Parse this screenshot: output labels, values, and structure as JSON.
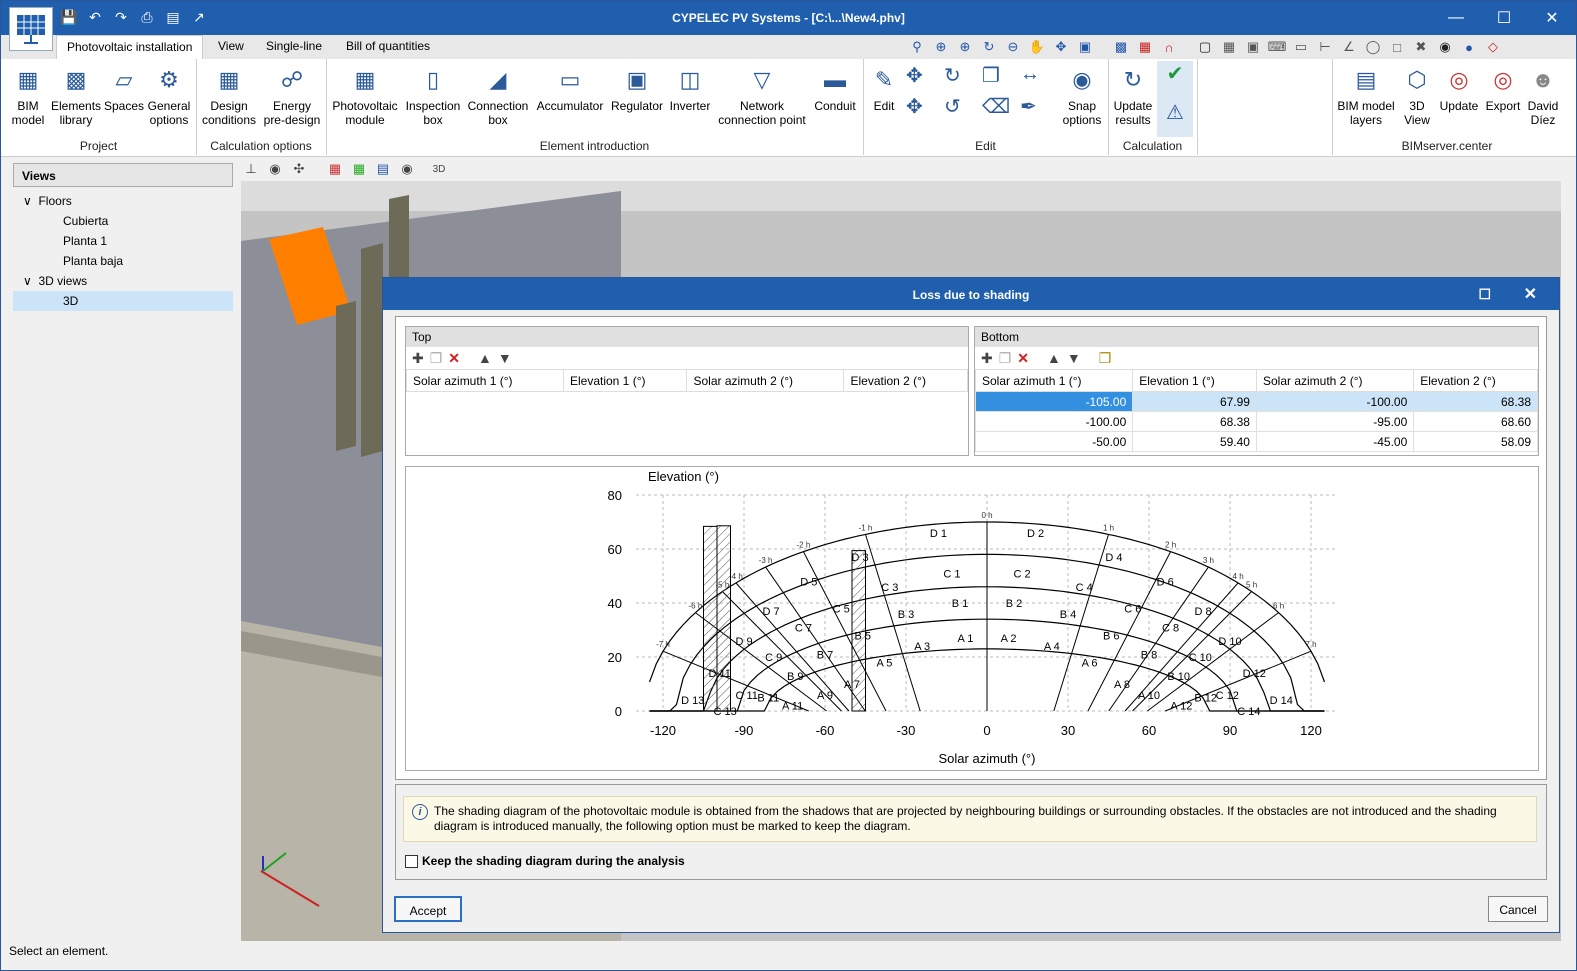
{
  "window": {
    "title": "CYPELEC PV Systems - [C:\\...\\New4.phv]"
  },
  "tabs": [
    {
      "label": "Photovoltaic installation"
    },
    {
      "label": "View"
    },
    {
      "label": "Single-line"
    },
    {
      "label": "Bill of quantities"
    }
  ],
  "ribbon": {
    "buttons": {
      "bim_model": "BIM\nmodel",
      "elements_library": "Elements\nlibrary",
      "spaces": "Spaces",
      "general_options": "General\noptions",
      "design_conditions": "Design\nconditions",
      "energy_predesign": "Energy\npre-design",
      "pv_module": "Photovoltaic\nmodule",
      "inspection_box": "Inspection\nbox",
      "connection_box": "Connection\nbox",
      "accumulator": "Accumulator",
      "regulator": "Regulator",
      "inverter": "Inverter",
      "network_point": "Network\nconnection point",
      "conduit": "Conduit",
      "edit": "Edit",
      "snap_options": "Snap\noptions",
      "update_results": "Update\nresults",
      "bim_layers": "BIM model\nlayers",
      "view3d": "3D\nView",
      "update": "Update",
      "export": "Export",
      "user": "David\nDíez"
    },
    "groups": {
      "project": "Project",
      "calc_options": "Calculation options",
      "element_intro": "Element introduction",
      "edit": "Edit",
      "calculation": "Calculation",
      "bimserver": "BIMserver.center"
    }
  },
  "sidebar": {
    "header": "Views",
    "floors_label": "Floors",
    "floors": [
      "Cubierta",
      "Planta 1",
      "Planta baja"
    ],
    "views_label": "3D views",
    "views": [
      "3D"
    ]
  },
  "status": "Select an element.",
  "dialog": {
    "title": "Loss due to shading",
    "top": {
      "label": "Top",
      "columns": [
        "Solar azimuth 1 (°)",
        "Elevation 1 (°)",
        "Solar azimuth 2 (°)",
        "Elevation 2 (°)"
      ]
    },
    "bottom": {
      "label": "Bottom",
      "columns": [
        "Solar azimuth 1 (°)",
        "Elevation 1 (°)",
        "Solar azimuth 2 (°)",
        "Elevation 2 (°)"
      ],
      "rows": [
        [
          "-105.00",
          "67.99",
          "-100.00",
          "68.38"
        ],
        [
          "-100.00",
          "68.38",
          "-95.00",
          "68.60"
        ],
        [
          "-50.00",
          "59.40",
          "-45.00",
          "58.09"
        ]
      ]
    },
    "info": "The shading diagram of the photovoltaic module is obtained from the shadows that are projected by neighbouring buildings or surrounding obstacles. If the obstacles are not introduced and the shading diagram is introduced manually, the following option must be marked to keep the diagram.",
    "checkbox_label": "Keep the shading diagram during the analysis",
    "accept": "Accept",
    "cancel": "Cancel"
  },
  "chart_data": {
    "type": "scatter",
    "xlabel": "Solar azimuth (°)",
    "ylabel": "Elevation (°)",
    "xlim": [
      -130,
      130
    ],
    "ylim": [
      0,
      80
    ],
    "xticks": [
      -120,
      -90,
      -60,
      -30,
      0,
      30,
      60,
      90,
      120
    ],
    "yticks": [
      0,
      20,
      40,
      60,
      80
    ],
    "grid": true,
    "sun_arcs_elevation_at_noon": [
      23,
      34,
      46,
      58,
      70
    ],
    "hour_labels": [
      "-7 h",
      "-6 h",
      "-5 h",
      "-4 h",
      "-3 h",
      "-2 h",
      "-1 h",
      "0 h",
      "1 h",
      "2 h",
      "3 h",
      "4 h",
      "5 h",
      "6 h",
      "7 h"
    ],
    "hour_azimuths": [
      -120,
      -108,
      -98,
      -93,
      -82,
      -68,
      -45,
      0,
      45,
      68,
      82,
      93,
      98,
      108,
      120
    ],
    "zones": [
      {
        "label": "D 1",
        "x": -18,
        "y": 66
      },
      {
        "label": "D 2",
        "x": 18,
        "y": 66
      },
      {
        "label": "D 3",
        "x": -47,
        "y": 57
      },
      {
        "label": "D 4",
        "x": 47,
        "y": 57
      },
      {
        "label": "D 5",
        "x": -66,
        "y": 48
      },
      {
        "label": "D 6",
        "x": 66,
        "y": 48
      },
      {
        "label": "D 7",
        "x": -80,
        "y": 37
      },
      {
        "label": "D 8",
        "x": 80,
        "y": 37
      },
      {
        "label": "D 9",
        "x": -90,
        "y": 26
      },
      {
        "label": "D 10",
        "x": 90,
        "y": 26
      },
      {
        "label": "D 11",
        "x": -99,
        "y": 14
      },
      {
        "label": "D 12",
        "x": 99,
        "y": 14
      },
      {
        "label": "D 13",
        "x": -109,
        "y": 4
      },
      {
        "label": "D 14",
        "x": 109,
        "y": 4
      },
      {
        "label": "C 1",
        "x": -13,
        "y": 51
      },
      {
        "label": "C 2",
        "x": 13,
        "y": 51
      },
      {
        "label": "C 3",
        "x": -36,
        "y": 46
      },
      {
        "label": "C 4",
        "x": 36,
        "y": 46
      },
      {
        "label": "C 5",
        "x": -54,
        "y": 38
      },
      {
        "label": "C 6",
        "x": 54,
        "y": 38
      },
      {
        "label": "C 7",
        "x": -68,
        "y": 31
      },
      {
        "label": "C 8",
        "x": 68,
        "y": 31
      },
      {
        "label": "C 9",
        "x": -79,
        "y": 20
      },
      {
        "label": "C 10",
        "x": 79,
        "y": 20
      },
      {
        "label": "C 11",
        "x": -89,
        "y": 6
      },
      {
        "label": "C 12",
        "x": 89,
        "y": 6
      },
      {
        "label": "C 13",
        "x": -97,
        "y": 0
      },
      {
        "label": "C 14",
        "x": 97,
        "y": 0
      },
      {
        "label": "B 1",
        "x": -10,
        "y": 40
      },
      {
        "label": "B 2",
        "x": 10,
        "y": 40
      },
      {
        "label": "B 3",
        "x": -30,
        "y": 36
      },
      {
        "label": "B 4",
        "x": 30,
        "y": 36
      },
      {
        "label": "B 5",
        "x": -46,
        "y": 28
      },
      {
        "label": "B 6",
        "x": 46,
        "y": 28
      },
      {
        "label": "B 7",
        "x": -60,
        "y": 21
      },
      {
        "label": "B 8",
        "x": 60,
        "y": 21
      },
      {
        "label": "B 9",
        "x": -71,
        "y": 13
      },
      {
        "label": "B 10",
        "x": 71,
        "y": 13
      },
      {
        "label": "B 11",
        "x": -81,
        "y": 5
      },
      {
        "label": "B 12",
        "x": 81,
        "y": 5
      },
      {
        "label": "A 1",
        "x": -8,
        "y": 27
      },
      {
        "label": "A 2",
        "x": 8,
        "y": 27
      },
      {
        "label": "A 3",
        "x": -24,
        "y": 24
      },
      {
        "label": "A 4",
        "x": 24,
        "y": 24
      },
      {
        "label": "A 5",
        "x": -38,
        "y": 18
      },
      {
        "label": "A 6",
        "x": 38,
        "y": 18
      },
      {
        "label": "A 7",
        "x": -50,
        "y": 10
      },
      {
        "label": "A 8",
        "x": 50,
        "y": 10
      },
      {
        "label": "A 9",
        "x": -60,
        "y": 6
      },
      {
        "label": "A 10",
        "x": 60,
        "y": 6
      },
      {
        "label": "A 11",
        "x": -72,
        "y": 2
      },
      {
        "label": "A 12",
        "x": 72,
        "y": 2
      }
    ],
    "obstacles": [
      {
        "x1": -105,
        "x2": -100,
        "y1": 67.99,
        "y2": 68.38
      },
      {
        "x1": -100,
        "x2": -95,
        "y1": 68.38,
        "y2": 68.6
      },
      {
        "x1": -50,
        "x2": -45,
        "y1": 59.4,
        "y2": 58.09
      }
    ]
  }
}
